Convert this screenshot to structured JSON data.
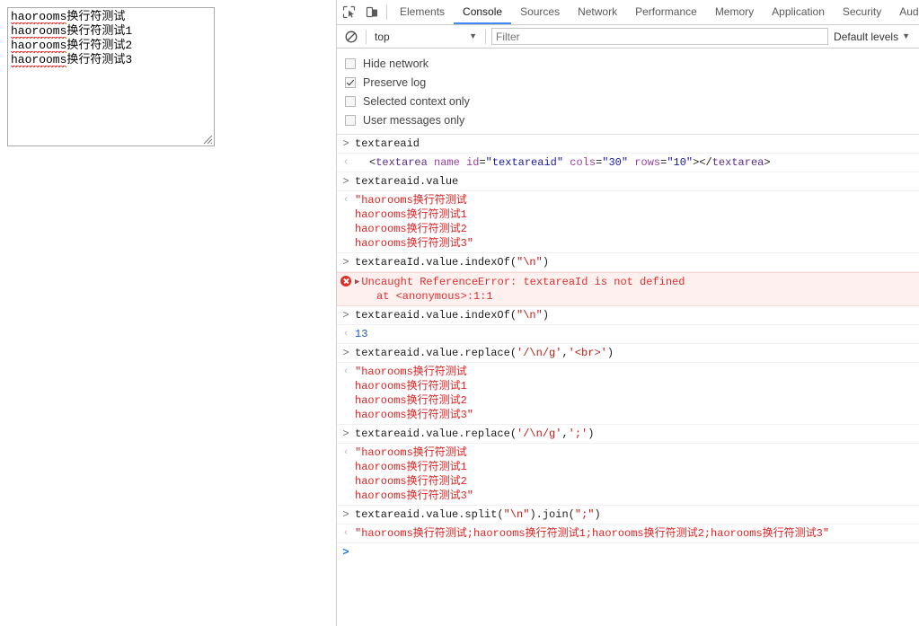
{
  "page": {
    "textarea": {
      "name": "textareaid-field",
      "rows": 10,
      "cols": 30,
      "lines": [
        {
          "word": "haorooms",
          "rest": "换行符测试"
        },
        {
          "word": "haorooms",
          "rest": "换行符测试1"
        },
        {
          "word": "haorooms",
          "rest": "换行符测试2"
        },
        {
          "word": "haorooms",
          "rest": "换行符测试3"
        }
      ]
    }
  },
  "devtools": {
    "icons": {
      "inspect": "inspect-element-icon",
      "device": "device-toolbar-icon",
      "clear": "clear-console-icon"
    },
    "tabs": [
      {
        "label": "Elements",
        "active": false
      },
      {
        "label": "Console",
        "active": true
      },
      {
        "label": "Sources",
        "active": false
      },
      {
        "label": "Network",
        "active": false
      },
      {
        "label": "Performance",
        "active": false
      },
      {
        "label": "Memory",
        "active": false
      },
      {
        "label": "Application",
        "active": false
      },
      {
        "label": "Security",
        "active": false
      },
      {
        "label": "Aud",
        "active": false
      }
    ],
    "active_tab_color": "#4285f4",
    "filterbar": {
      "context": "top",
      "context_caret": "▼",
      "filter_placeholder": "Filter",
      "filter_value": "",
      "levels_label": "Default levels",
      "levels_caret": "▼"
    },
    "checkboxes": [
      {
        "label": "Hide network",
        "checked": false
      },
      {
        "label": "Preserve log",
        "checked": true
      },
      {
        "label": "Selected context only",
        "checked": false
      },
      {
        "label": "User messages only",
        "checked": false
      }
    ],
    "console": {
      "input_marker": ">",
      "output_marker": "‹",
      "prompt_marker": ">",
      "entries": [
        {
          "kind": "input",
          "text": "textareaid"
        },
        {
          "kind": "output-html",
          "indent": true,
          "tokens": [
            {
              "t": "punct",
              "v": "<"
            },
            {
              "t": "tagname",
              "v": "textarea"
            },
            {
              "t": "punct",
              "v": " "
            },
            {
              "t": "attrname",
              "v": "name"
            },
            {
              "t": "punct",
              "v": " "
            },
            {
              "t": "attrname",
              "v": "id"
            },
            {
              "t": "punct",
              "v": "="
            },
            {
              "t": "attrval",
              "v": "\"textareaid\""
            },
            {
              "t": "punct",
              "v": " "
            },
            {
              "t": "attrname",
              "v": "cols"
            },
            {
              "t": "punct",
              "v": "="
            },
            {
              "t": "attrval",
              "v": "\"30\""
            },
            {
              "t": "punct",
              "v": " "
            },
            {
              "t": "attrname",
              "v": "rows"
            },
            {
              "t": "punct",
              "v": "="
            },
            {
              "t": "attrval",
              "v": "\"10\""
            },
            {
              "t": "punct",
              "v": "></"
            },
            {
              "t": "tagname",
              "v": "textarea"
            },
            {
              "t": "punct",
              "v": ">"
            }
          ]
        },
        {
          "kind": "input",
          "text": "textareaid.value"
        },
        {
          "kind": "output-string",
          "value": "\"haorooms换行符测试\nhaorooms换行符测试1\nhaorooms换行符测试2\nhaorooms换行符测试3\""
        },
        {
          "kind": "input-tokens",
          "tokens": [
            {
              "t": "plain",
              "v": "textareaId.value.indexOf("
            },
            {
              "t": "str",
              "v": "\"\\n\""
            },
            {
              "t": "plain",
              "v": ")"
            }
          ]
        },
        {
          "kind": "error",
          "message": "Uncaught ReferenceError: textareaId is not defined",
          "stack": "at <anonymous>:1:1",
          "disclosure": "▶"
        },
        {
          "kind": "input-tokens",
          "tokens": [
            {
              "t": "plain",
              "v": "textareaid.value.indexOf("
            },
            {
              "t": "str",
              "v": "\"\\n\""
            },
            {
              "t": "plain",
              "v": ")"
            }
          ]
        },
        {
          "kind": "output-number",
          "value": "13"
        },
        {
          "kind": "input-tokens",
          "tokens": [
            {
              "t": "plain",
              "v": "textareaid.value.replace("
            },
            {
              "t": "str",
              "v": "'/\\n/g'"
            },
            {
              "t": "plain",
              "v": ","
            },
            {
              "t": "str",
              "v": "'<br>'"
            },
            {
              "t": "plain",
              "v": ")"
            }
          ]
        },
        {
          "kind": "output-string",
          "value": "\"haorooms换行符测试\nhaorooms换行符测试1\nhaorooms换行符测试2\nhaorooms换行符测试3\""
        },
        {
          "kind": "input-tokens",
          "tokens": [
            {
              "t": "plain",
              "v": "textareaid.value.replace("
            },
            {
              "t": "str",
              "v": "'/\\n/g'"
            },
            {
              "t": "plain",
              "v": ","
            },
            {
              "t": "str",
              "v": "';'"
            },
            {
              "t": "plain",
              "v": ")"
            }
          ]
        },
        {
          "kind": "output-string",
          "value": "\"haorooms换行符测试\nhaorooms换行符测试1\nhaorooms换行符测试2\nhaorooms换行符测试3\""
        },
        {
          "kind": "input-tokens",
          "tokens": [
            {
              "t": "plain",
              "v": "textareaid.value.split("
            },
            {
              "t": "str",
              "v": "\"\\n\""
            },
            {
              "t": "plain",
              "v": ").join("
            },
            {
              "t": "str",
              "v": "\";\""
            },
            {
              "t": "plain",
              "v": ")"
            }
          ]
        },
        {
          "kind": "output-string",
          "value": "\"haorooms换行符测试;haorooms换行符测试1;haorooms换行符测试2;haorooms换行符测试3\""
        },
        {
          "kind": "prompt"
        }
      ]
    }
  }
}
